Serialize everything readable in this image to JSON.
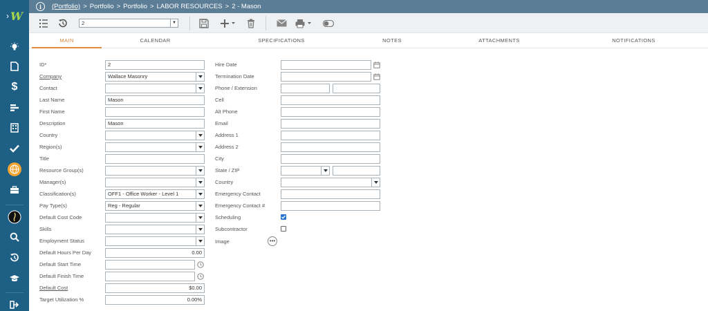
{
  "breadcrumb": {
    "link": "(Portfolio)",
    "segments": [
      "Portfolio",
      "Portfolio",
      "LABOR RESOURCES",
      "2 - Mason"
    ]
  },
  "toolbar": {
    "record_select_value": "2"
  },
  "tabs": [
    "MAIN",
    "CALENDAR",
    "SPECIFICATIONS",
    "NOTES",
    "ATTACHMENTS",
    "NOTIFICATIONS"
  ],
  "left_fields": {
    "id": {
      "label": "ID*",
      "value": "2"
    },
    "company": {
      "label": "Company",
      "value": "Wallace Masonry"
    },
    "contact": {
      "label": "Contact",
      "value": ""
    },
    "last_name": {
      "label": "Last Name",
      "value": "Mason"
    },
    "first_name": {
      "label": "First Name",
      "value": ""
    },
    "description": {
      "label": "Description",
      "value": "Mason"
    },
    "country": {
      "label": "Country",
      "value": ""
    },
    "regions": {
      "label": "Region(s)",
      "value": ""
    },
    "title": {
      "label": "Title",
      "value": ""
    },
    "resource_groups": {
      "label": "Resource Group(s)",
      "value": ""
    },
    "managers": {
      "label": "Manager(s)",
      "value": ""
    },
    "classifications": {
      "label": "Classification(s)",
      "value": "OFF1 - Office Worker - Level 1"
    },
    "pay_types": {
      "label": "Pay Type(s)",
      "value": "Reg - Regular"
    },
    "default_cost_code": {
      "label": "Default Cost Code",
      "value": ""
    },
    "skills": {
      "label": "Skills",
      "value": ""
    },
    "employment_status": {
      "label": "Employment Status",
      "value": ""
    },
    "default_hours": {
      "label": "Default Hours Per Day",
      "value": "0.00"
    },
    "default_start": {
      "label": "Default Start Time",
      "value": ""
    },
    "default_finish": {
      "label": "Default Finish Time",
      "value": ""
    },
    "default_cost": {
      "label": "Default Cost",
      "value": "$0.00"
    },
    "target_util": {
      "label": "Target Utilization %",
      "value": "0.00%"
    }
  },
  "right_fields": {
    "hire_date": {
      "label": "Hire Date",
      "value": ""
    },
    "termination_date": {
      "label": "Termination Date",
      "value": ""
    },
    "phone": {
      "label": "Phone / Extension",
      "value": "",
      "ext": ""
    },
    "cell": {
      "label": "Cell",
      "value": ""
    },
    "alt_phone": {
      "label": "Alt Phone",
      "value": ""
    },
    "email": {
      "label": "Email",
      "value": ""
    },
    "address1": {
      "label": "Address 1",
      "value": ""
    },
    "address2": {
      "label": "Address 2",
      "value": ""
    },
    "city": {
      "label": "City",
      "value": ""
    },
    "state_zip": {
      "label": "State / ZIP",
      "state": "",
      "zip": ""
    },
    "country": {
      "label": "Country",
      "value": ""
    },
    "emergency_contact": {
      "label": "Emergency Contact",
      "value": ""
    },
    "emergency_contact_num": {
      "label": "Emergency Contact #",
      "value": ""
    },
    "scheduling": {
      "label": "Scheduling",
      "checked": true
    },
    "subcontractor": {
      "label": "Subcontractor",
      "checked": false
    },
    "image": {
      "label": "Image"
    }
  },
  "colors": {
    "sidebar": "#1e5f86",
    "topbar": "#5c7d96",
    "active_tab": "#e08a3c",
    "logo": "#a5d64c",
    "checkbox": "#2a74d0",
    "globe": "#f0a331"
  },
  "sidebar_icons": [
    "menu-expand-icon",
    "lightbulb-icon",
    "document-icon",
    "dollar-icon",
    "bar-chart-icon",
    "building-icon",
    "checkmark-icon",
    "globe-icon",
    "briefcase-icon",
    "user-avatar-icon",
    "search-icon",
    "history-icon",
    "graduation-cap-icon",
    "logout-icon"
  ]
}
